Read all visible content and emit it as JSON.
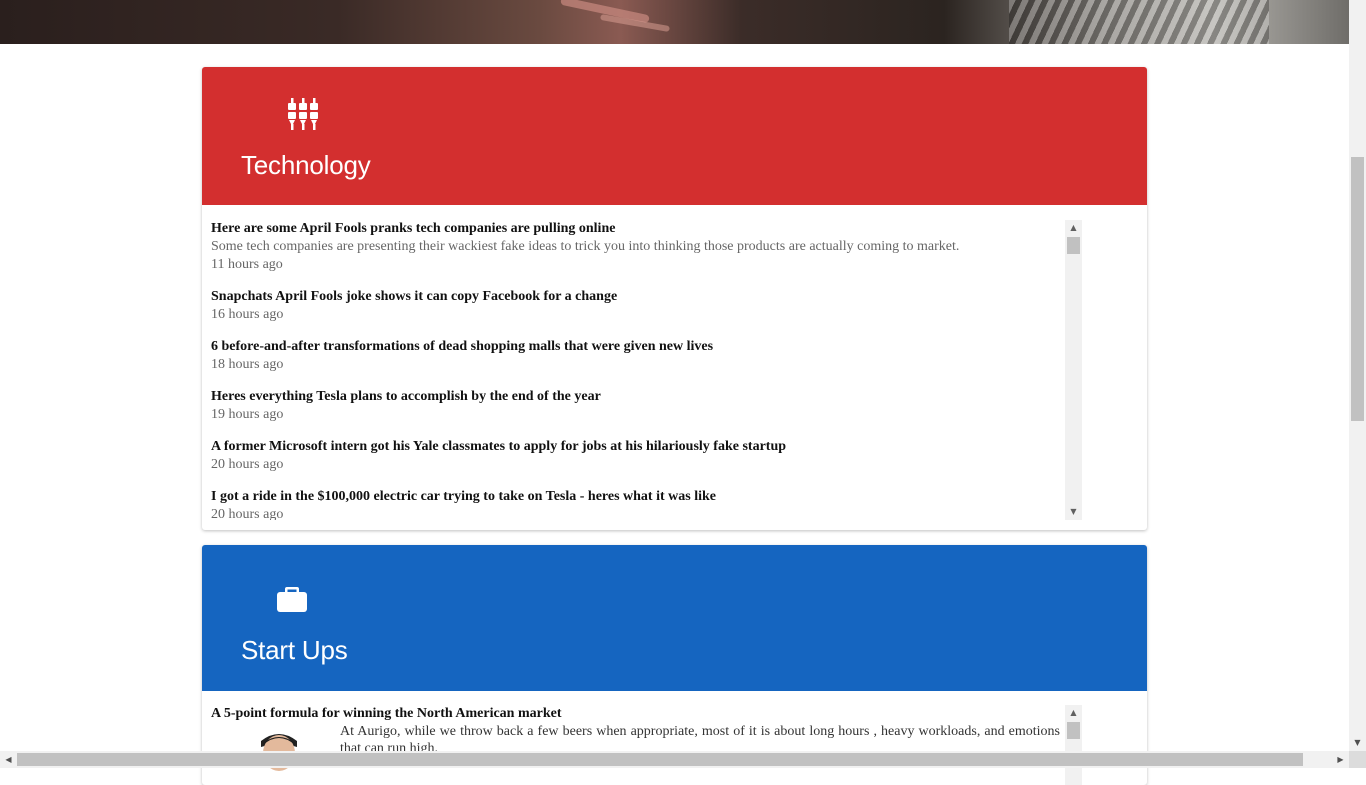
{
  "hero": {
    "image_name": "hero-banner-image"
  },
  "technology": {
    "title": "Technology",
    "icon": "settings-sliders-icon",
    "header_color": "#d32f2f",
    "articles": [
      {
        "title": "Here are some April Fools pranks tech companies are pulling online",
        "description": "Some tech companies are presenting their wackiest fake ideas to trick you into thinking those products are actually coming to market.",
        "time": "11 hours ago"
      },
      {
        "title": "Snapchats April Fools joke shows it can copy Facebook for a change",
        "time": "16 hours ago"
      },
      {
        "title": "6 before-and-after transformations of dead shopping malls that were given new lives",
        "time": "18 hours ago"
      },
      {
        "title": "Heres everything Tesla plans to accomplish by the end of the year",
        "time": "19 hours ago"
      },
      {
        "title": "A former Microsoft intern got his Yale classmates to apply for jobs at his hilariously fake startup",
        "time": "20 hours ago"
      },
      {
        "title": "I got a ride in the $100,000 electric car trying to take on Tesla - heres what it was like",
        "time": "20 hours ago"
      }
    ]
  },
  "startups": {
    "title": "Start Ups",
    "icon": "briefcase-icon",
    "header_color": "#1565c0",
    "articles": [
      {
        "title": "A 5-point formula for winning the North American market",
        "description": "At Aurigo, while we throw back a few beers when appropriate, most of it is about long hours , heavy workloads, and emotions that can run high."
      }
    ]
  },
  "scrollbars": {
    "up_arrow": "▲",
    "down_arrow": "▼",
    "left_arrow": "◀",
    "right_arrow": "▶"
  }
}
